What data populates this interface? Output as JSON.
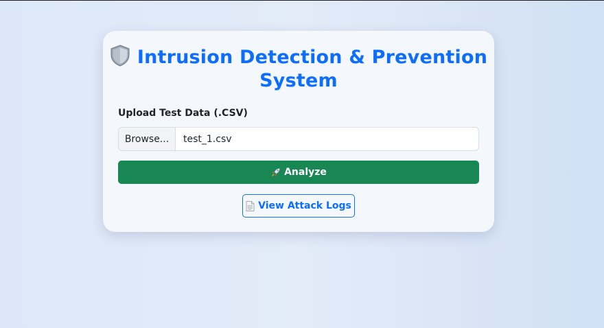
{
  "header": {
    "title": "Intrusion Detection & Prevention System",
    "title_icon": "shield-icon"
  },
  "upload": {
    "label": "Upload Test Data (.CSV)",
    "browse_label": "Browse...",
    "file_name": "test_1.csv"
  },
  "actions": {
    "analyze_label": "Analyze",
    "analyze_icon": "rocket-icon",
    "logs_label": "View Attack Logs",
    "logs_icon": "document-icon"
  },
  "colors": {
    "accent": "#0d6efd",
    "success": "#198754",
    "card": "#f4f7fc"
  }
}
